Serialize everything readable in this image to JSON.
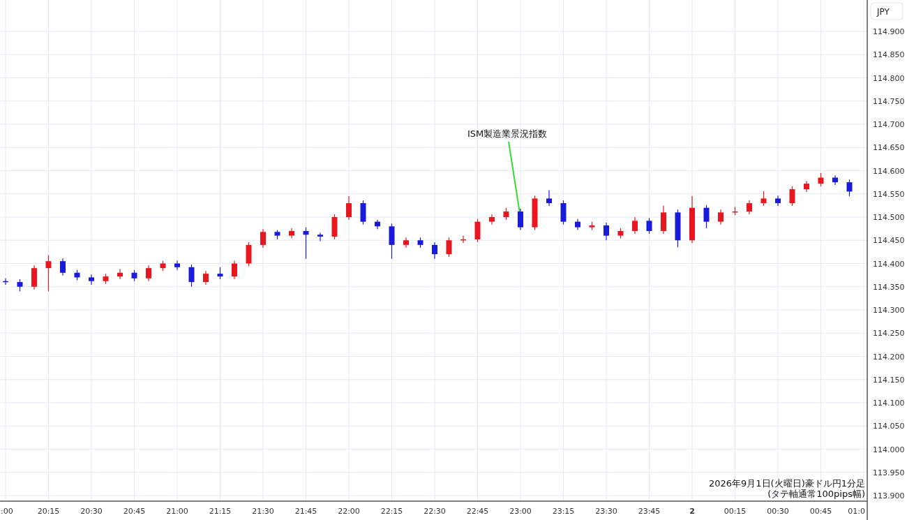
{
  "chart": {
    "chart_data": {
      "type": "candlestick",
      "ylabel": "JPY",
      "categories": [
        ":00",
        null,
        null,
        "20:15",
        null,
        null,
        "20:30",
        null,
        null,
        "20:45",
        null,
        null,
        "21:00",
        null,
        null,
        "21:15",
        null,
        null,
        "21:30",
        null,
        null,
        "21:45",
        null,
        null,
        "22:00",
        null,
        null,
        "22:15",
        null,
        null,
        "22:30",
        null,
        null,
        "22:45",
        null,
        null,
        "23:00",
        null,
        null,
        "23:15",
        null,
        null,
        "23:30",
        null,
        null,
        "23:45",
        null,
        null,
        "2",
        null,
        null,
        "00:15",
        null,
        null,
        "00:30",
        null,
        null,
        "00:45",
        null,
        null,
        "01:0"
      ],
      "ohlc": [
        [
          114.362,
          114.368,
          114.354,
          114.36
        ],
        [
          114.36,
          114.366,
          114.34,
          114.35
        ],
        [
          114.35,
          114.396,
          114.344,
          114.39
        ],
        [
          114.39,
          114.418,
          114.34,
          114.405
        ],
        [
          114.405,
          114.411,
          114.374,
          114.38
        ],
        [
          114.38,
          114.386,
          114.364,
          114.37
        ],
        [
          114.37,
          114.376,
          114.354,
          114.362
        ],
        [
          114.362,
          114.378,
          114.356,
          114.372
        ],
        [
          114.372,
          114.388,
          114.366,
          114.38
        ],
        [
          114.38,
          114.386,
          114.362,
          114.368
        ],
        [
          114.368,
          114.396,
          114.362,
          114.39
        ],
        [
          114.39,
          114.406,
          114.384,
          114.4
        ],
        [
          114.4,
          114.406,
          114.386,
          114.392
        ],
        [
          114.392,
          114.398,
          114.35,
          114.36
        ],
        [
          114.36,
          114.384,
          114.354,
          114.378
        ],
        [
          114.378,
          114.392,
          114.366,
          114.372
        ],
        [
          114.372,
          114.406,
          114.366,
          114.4
        ],
        [
          114.4,
          114.446,
          114.394,
          114.44
        ],
        [
          114.44,
          114.474,
          114.434,
          114.468
        ],
        [
          114.468,
          114.472,
          114.452,
          114.46
        ],
        [
          114.46,
          114.476,
          114.454,
          114.47
        ],
        [
          114.47,
          114.478,
          114.41,
          114.462
        ],
        [
          114.462,
          114.466,
          114.448,
          114.458
        ],
        [
          114.458,
          114.506,
          114.452,
          114.5
        ],
        [
          114.5,
          114.545,
          114.494,
          114.53
        ],
        [
          114.53,
          114.536,
          114.484,
          114.49
        ],
        [
          114.49,
          114.494,
          114.474,
          114.48
        ],
        [
          114.48,
          114.486,
          114.41,
          114.44
        ],
        [
          114.44,
          114.456,
          114.434,
          114.45
        ],
        [
          114.45,
          114.456,
          114.434,
          114.44
        ],
        [
          114.44,
          114.446,
          114.41,
          114.42
        ],
        [
          114.42,
          114.456,
          114.414,
          114.45
        ],
        [
          114.45,
          114.46,
          114.444,
          114.452
        ],
        [
          114.452,
          114.496,
          114.446,
          114.49
        ],
        [
          114.49,
          114.506,
          114.484,
          114.5
        ],
        [
          114.5,
          114.52,
          114.494,
          114.512
        ],
        [
          114.512,
          114.518,
          114.472,
          114.478
        ],
        [
          114.478,
          114.546,
          114.472,
          114.54
        ],
        [
          114.54,
          114.558,
          114.524,
          114.53
        ],
        [
          114.53,
          114.536,
          114.484,
          114.49
        ],
        [
          114.49,
          114.496,
          114.472,
          114.478
        ],
        [
          114.478,
          114.49,
          114.472,
          114.482
        ],
        [
          114.482,
          114.488,
          114.45,
          114.46
        ],
        [
          114.46,
          114.476,
          114.454,
          114.47
        ],
        [
          114.47,
          114.5,
          114.464,
          114.492
        ],
        [
          114.492,
          114.498,
          114.464,
          114.47
        ],
        [
          114.47,
          114.525,
          114.464,
          114.51
        ],
        [
          114.51,
          114.516,
          114.435,
          114.45
        ],
        [
          114.45,
          114.545,
          114.444,
          114.52
        ],
        [
          114.52,
          114.526,
          114.476,
          114.49
        ],
        [
          114.49,
          114.516,
          114.484,
          114.51
        ],
        [
          114.51,
          114.522,
          114.504,
          114.512
        ],
        [
          114.512,
          114.536,
          114.506,
          114.53
        ],
        [
          114.53,
          114.556,
          114.524,
          114.54
        ],
        [
          114.54,
          114.546,
          114.524,
          114.53
        ],
        [
          114.53,
          114.566,
          114.524,
          114.56
        ],
        [
          114.56,
          114.578,
          114.554,
          114.572
        ],
        [
          114.572,
          114.595,
          114.566,
          114.585
        ],
        [
          114.585,
          114.59,
          114.569,
          114.575
        ],
        [
          114.575,
          114.581,
          114.545,
          114.555
        ],
        null
      ],
      "ylim": [
        113.9,
        114.9
      ],
      "grid": true,
      "yticks": [
        {
          "value": 114.9,
          "label": "114.900"
        },
        {
          "value": 114.85,
          "label": "114.850"
        },
        {
          "value": 114.8,
          "label": "114.800"
        },
        {
          "value": 114.75,
          "label": "114.750"
        },
        {
          "value": 114.7,
          "label": "114.700"
        },
        {
          "value": 114.65,
          "label": "114.650"
        },
        {
          "value": 114.6,
          "label": "114.600"
        },
        {
          "value": 114.55,
          "label": "114.550"
        },
        {
          "value": 114.5,
          "label": "114.500"
        },
        {
          "value": 114.45,
          "label": "114.450"
        },
        {
          "value": 114.4,
          "label": "114.400"
        },
        {
          "value": 114.35,
          "label": "114.350"
        },
        {
          "value": 114.3,
          "label": "114.300"
        },
        {
          "value": 114.25,
          "label": "114.250"
        },
        {
          "value": 114.2,
          "label": "114.200"
        },
        {
          "value": 114.15,
          "label": "114.150"
        },
        {
          "value": 114.1,
          "label": "114.100"
        },
        {
          "value": 114.05,
          "label": "114.050"
        },
        {
          "value": 114.0,
          "label": "114.000"
        },
        {
          "value": 113.95,
          "label": "113.950"
        },
        {
          "value": 113.9,
          "label": "113.900"
        }
      ],
      "annotations": [
        "ISM製造業景況指数"
      ]
    }
  },
  "caption_lines": [
    "2026年9月1日(火曜日)豪ドル円1分足",
    "(タテ軸通常100pips幅)"
  ]
}
